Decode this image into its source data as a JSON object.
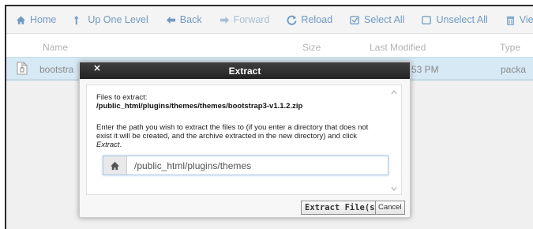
{
  "toolbar": {
    "home": "Home",
    "up_one_level": "Up One Level",
    "back": "Back",
    "forward": "Forward",
    "reload": "Reload",
    "select_all": "Select All",
    "unselect_all": "Unselect All",
    "view_trash": "View Trash"
  },
  "columns": {
    "name": "Name",
    "size": "Size",
    "last_modified": "Last Modified",
    "type": "Type"
  },
  "file_row": {
    "name": "bootstra",
    "last_modified": "53 PM",
    "type": "packa"
  },
  "dialog": {
    "title": "Extract",
    "close_label": "×",
    "files_label": "Files to extract:",
    "zip_path": "/public_html/plugins/themes/themes/bootstrap3-v1.1.2.zip",
    "instructions": "Enter the path you wish to extract the files to (if you enter a directory that does not exist it will be created, and the archive extracted in the new directory) and click ",
    "instructions_action": "Extract",
    "instructions_end": ".",
    "path_value": "/public_html/plugins/themes",
    "extract_button": "Extract File(s)",
    "cancel_button": "Cancel"
  },
  "icons": {
    "home": "home-icon",
    "up": "arrow-up-icon",
    "back": "arrow-left-icon",
    "forward": "arrow-right-icon",
    "reload": "refresh-icon",
    "select_all": "checked-box-icon",
    "unselect_all": "empty-box-icon",
    "trash": "trash-icon",
    "file": "archive-file-icon"
  },
  "colors": {
    "toolbar_link": "#6f9ac4",
    "toolbar_link_disabled": "#a9bfd4",
    "selected_row": "#d6e9f5",
    "titlebar": "#2e2e2e"
  }
}
